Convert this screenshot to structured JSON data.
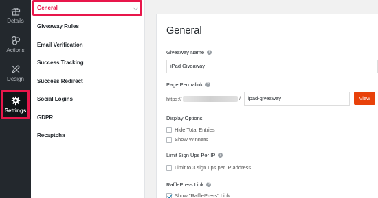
{
  "rail": {
    "items": [
      {
        "label": "Details",
        "icon": "gift-icon"
      },
      {
        "label": "Actions",
        "icon": "actions-icon"
      },
      {
        "label": "Design",
        "icon": "design-icon"
      },
      {
        "label": "Settings",
        "icon": "gear-icon"
      }
    ]
  },
  "submenu": {
    "items": [
      {
        "label": "General"
      },
      {
        "label": "Giveaway Rules"
      },
      {
        "label": "Email Verification"
      },
      {
        "label": "Success Tracking"
      },
      {
        "label": "Success Redirect"
      },
      {
        "label": "Social Logins"
      },
      {
        "label": "GDPR"
      },
      {
        "label": "Recaptcha"
      }
    ]
  },
  "main": {
    "title": "General",
    "giveaway_name": {
      "label": "Giveaway Name",
      "value": "iPad Giveaway"
    },
    "permalink": {
      "label": "Page Permalink",
      "prefix": "https://",
      "slash": "/",
      "value": "ipad-giveaway",
      "view_label": "View"
    },
    "display_options": {
      "label": "Display Options",
      "options": [
        {
          "label": "Hide Total Entries",
          "checked": false
        },
        {
          "label": "Show Winners",
          "checked": false
        }
      ]
    },
    "limit": {
      "label": "Limit Sign Ups Per IP",
      "option": {
        "label": "Limit to 3 sign ups per IP address.",
        "checked": false
      }
    },
    "rafflepress_link": {
      "label": "RafflePress Link",
      "option": {
        "label": "Show \"RafflePress\" Link",
        "checked": true
      }
    }
  },
  "colors": {
    "accent": "#e8174b",
    "view_button": "#e8410a",
    "rail_bg": "#23282d"
  }
}
